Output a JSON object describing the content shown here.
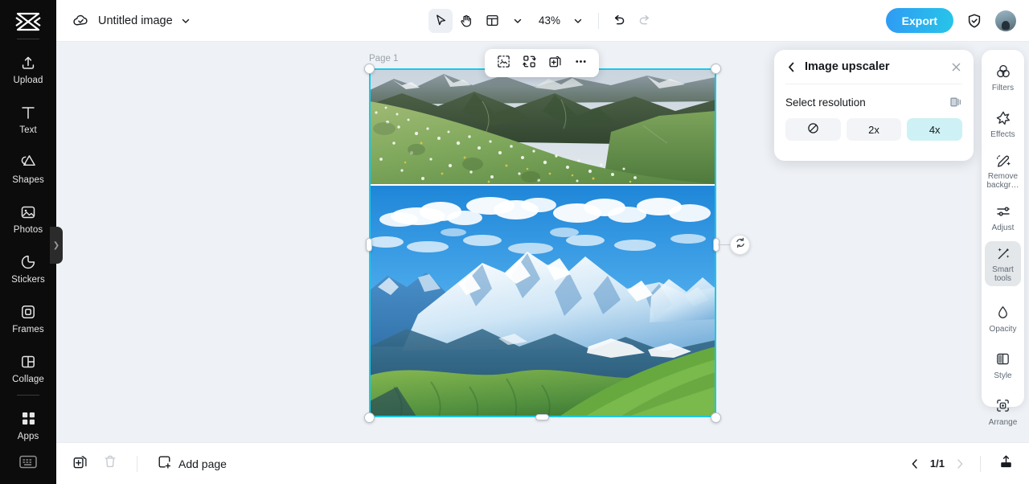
{
  "app": {
    "logo_icon": "capcut-logo-icon"
  },
  "left_sidebar": {
    "items": [
      {
        "label": "Upload",
        "icon": "upload-icon"
      },
      {
        "label": "Text",
        "icon": "text-icon"
      },
      {
        "label": "Shapes",
        "icon": "shapes-icon"
      },
      {
        "label": "Photos",
        "icon": "photos-icon"
      },
      {
        "label": "Stickers",
        "icon": "stickers-icon"
      },
      {
        "label": "Frames",
        "icon": "frames-icon"
      },
      {
        "label": "Collage",
        "icon": "collage-icon"
      },
      {
        "label": "Apps",
        "icon": "apps-icon"
      }
    ],
    "bottom_icon": "keyboard-shortcuts-icon",
    "expand_icon": "chevron-right-icon"
  },
  "topbar": {
    "cloud_icon": "cloud-saved-icon",
    "doc_title": "Untitled image",
    "title_caret": "chevron-down-icon",
    "tools": [
      {
        "name": "select-tool",
        "icon": "cursor-arrow-icon",
        "active": true
      },
      {
        "name": "hand-tool",
        "icon": "hand-icon",
        "active": false
      },
      {
        "name": "layout-tool",
        "icon": "layout-icon",
        "active": false
      }
    ],
    "layout_caret": "chevron-down-icon",
    "zoom_value": "43%",
    "zoom_caret": "chevron-down-icon",
    "undo_icon": "undo-icon",
    "redo_icon": "redo-icon",
    "export_label": "Export",
    "shield_icon": "shield-check-icon",
    "avatar_icon": "user-avatar"
  },
  "canvas": {
    "page_label": "Page 1",
    "context_toolbar": [
      {
        "name": "crop-image-button",
        "icon": "crop-dashed-icon"
      },
      {
        "name": "replace-image-button",
        "icon": "replace-swap-icon"
      },
      {
        "name": "duplicate-button",
        "icon": "duplicate-icon"
      },
      {
        "name": "more-options-button",
        "icon": "ellipsis-icon"
      }
    ],
    "rotate_icon": "rotate-icon"
  },
  "panel": {
    "back_icon": "chevron-left-icon",
    "title": "Image upscaler",
    "close_icon": "close-x-icon",
    "section_label": "Select resolution",
    "compare_icon": "compare-before-after-icon",
    "resolutions": [
      {
        "label": "",
        "icon": "none-forbidden-icon",
        "selected": false,
        "name": "resolution-none"
      },
      {
        "label": "2x",
        "icon": "",
        "selected": false,
        "name": "resolution-2x"
      },
      {
        "label": "4x",
        "icon": "",
        "selected": true,
        "name": "resolution-4x"
      }
    ],
    "selected_color": "#cdf1f5"
  },
  "right_sidebar": {
    "items": [
      {
        "label": "Filters",
        "icon": "filters-icon",
        "active": false
      },
      {
        "label": "Effects",
        "icon": "effects-star-icon",
        "active": false
      },
      {
        "label": "Remove backgr…",
        "icon": "remove-bg-icon",
        "active": false
      },
      {
        "label": "Adjust",
        "icon": "adjust-sliders-icon",
        "active": false
      },
      {
        "label": "Smart tools",
        "icon": "smart-tools-wand-icon",
        "active": true
      },
      {
        "label": "Opacity",
        "icon": "opacity-drop-icon",
        "active": false
      },
      {
        "label": "Style",
        "icon": "style-icon",
        "active": false
      },
      {
        "label": "Arrange",
        "icon": "arrange-icon",
        "active": false
      }
    ]
  },
  "bottombar": {
    "duplicate_page_icon": "duplicate-page-icon",
    "delete_page_icon": "trash-icon",
    "add_page_icon": "add-page-icon",
    "add_page_label": "Add page",
    "prev_icon": "chevron-left-icon",
    "page_indicator": "1/1",
    "next_icon": "chevron-right-icon",
    "export_icon": "export-upload-icon"
  },
  "theme": {
    "accent": "#19c9e8",
    "export_gradient_from": "#2f9bf5",
    "export_gradient_to": "#27c5e8",
    "canvas_bg": "#eef1f5",
    "rail_bg": "#0c0c0c"
  }
}
